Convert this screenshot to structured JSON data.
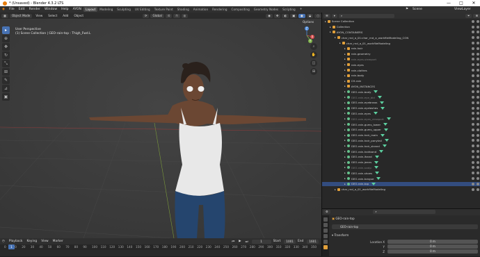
{
  "window": {
    "title": "* (Unsaved) - Blender 4.3.2 LTS",
    "controls": [
      "—",
      "□",
      "✕"
    ]
  },
  "menu": {
    "items": [
      "File",
      "Edit",
      "Render",
      "Window",
      "Help",
      "AYON"
    ]
  },
  "workspaces": [
    "Layout",
    "Modeling",
    "Sculpting",
    "UV Editing",
    "Texture Paint",
    "Shading",
    "Animation",
    "Rendering",
    "Compositing",
    "Geometry Nodes",
    "Scripting"
  ],
  "top_right": {
    "scene": "Scene",
    "view_layer": "ViewLayer"
  },
  "viewport": {
    "mode": "Object Mode",
    "menus": [
      "View",
      "Select",
      "Add",
      "Object"
    ],
    "orientation": "Global",
    "overlay_line1": "User Perspective",
    "overlay_line2": "(1) Scene Collection | GEO-rain-top : Thigh_Fwd.L",
    "options": "Options",
    "gizmo": {
      "x": "X",
      "y": "Y",
      "z": "Z"
    }
  },
  "timeline": {
    "menus": [
      "Playback",
      "Keying",
      "View",
      "Marker"
    ],
    "current_frame": "1",
    "start": "Start",
    "start_val": "1001",
    "end": "End",
    "end_val": "1601",
    "ticks": [
      "0",
      "10",
      "20",
      "30",
      "40",
      "50",
      "60",
      "70",
      "80",
      "90",
      "100",
      "110",
      "120",
      "130",
      "140",
      "150",
      "160",
      "170",
      "180",
      "190",
      "200",
      "210",
      "220",
      "230",
      "240",
      "250",
      "260",
      "270",
      "280",
      "290",
      "300",
      "310",
      "320",
      "330",
      "340",
      "350"
    ]
  },
  "outliner": {
    "items": [
      {
        "label": "Scene Collection",
        "indent": 0
      },
      {
        "label": "Collection",
        "indent": 1
      },
      {
        "label": "AYON_CONTAINERS",
        "indent": 1
      },
      {
        "label": "char_rnd_a_01:char_rnd_a_workfileModeling_CON",
        "indent": 2
      },
      {
        "label": "char_rnd_a_01_workfileModeling",
        "indent": 3
      },
      {
        "label": "rain-hair",
        "indent": 4
      },
      {
        "label": "rain-geometry",
        "indent": 4
      },
      {
        "label": "rain-eyes-viewport",
        "indent": 4
      },
      {
        "label": "rain-eyes",
        "indent": 4
      },
      {
        "label": "rain-clothes",
        "indent": 4
      },
      {
        "label": "rain-body",
        "indent": 4
      },
      {
        "label": "CH-rain",
        "indent": 4
      },
      {
        "label": "AYON_INSTANCES",
        "indent": 4
      },
      {
        "label": "GEO-rain-body",
        "indent": 4
      },
      {
        "label": "GEO-rain-eye_bbl",
        "indent": 4
      },
      {
        "label": "GEO-rain-eyebrows",
        "indent": 4
      },
      {
        "label": "GEO-rain-eyelashes",
        "indent": 4
      },
      {
        "label": "GEO-rain-eyes",
        "indent": 4
      },
      {
        "label": "GEO-rain-eyes_viewport",
        "indent": 4
      },
      {
        "label": "GEO-rain-gums_lower",
        "indent": 4
      },
      {
        "label": "GEO-rain-gums_upper",
        "indent": 4
      },
      {
        "label": "GEO-rain-hair_main",
        "indent": 4
      },
      {
        "label": "GEO-rain-hair_ponytail",
        "indent": 4
      },
      {
        "label": "GEO-rain-hair_strand",
        "indent": 4
      },
      {
        "label": "GEO-rain-hairband",
        "indent": 4
      },
      {
        "label": "GEO-rain-lhand",
        "indent": 4
      },
      {
        "label": "GEO-rain-jeans",
        "indent": 4
      },
      {
        "label": "GEO-rain-scalp",
        "indent": 4
      },
      {
        "label": "GEO-rain-shoes",
        "indent": 4
      },
      {
        "label": "GEO-rain-tongue",
        "indent": 4
      },
      {
        "label": "GEO-rain-top",
        "indent": 4
      },
      {
        "label": "char_rnd_a_01_workfileModeling",
        "indent": 2
      }
    ]
  },
  "properties": {
    "object": "GEO-rain-top",
    "name_field": "GEO-rain-top",
    "section": "Transform",
    "fields": [
      {
        "label": "Location X",
        "value": "0 m"
      },
      {
        "label": "Y",
        "value": "0 m"
      },
      {
        "label": "Z",
        "value": "0 m"
      }
    ]
  },
  "colors": {
    "accent": "#4772b3",
    "skin": "#6b4733",
    "jeans": "#25456e",
    "top": "#e8e8e8",
    "hair": "#2a211c",
    "floor": "#3a3a3a"
  }
}
